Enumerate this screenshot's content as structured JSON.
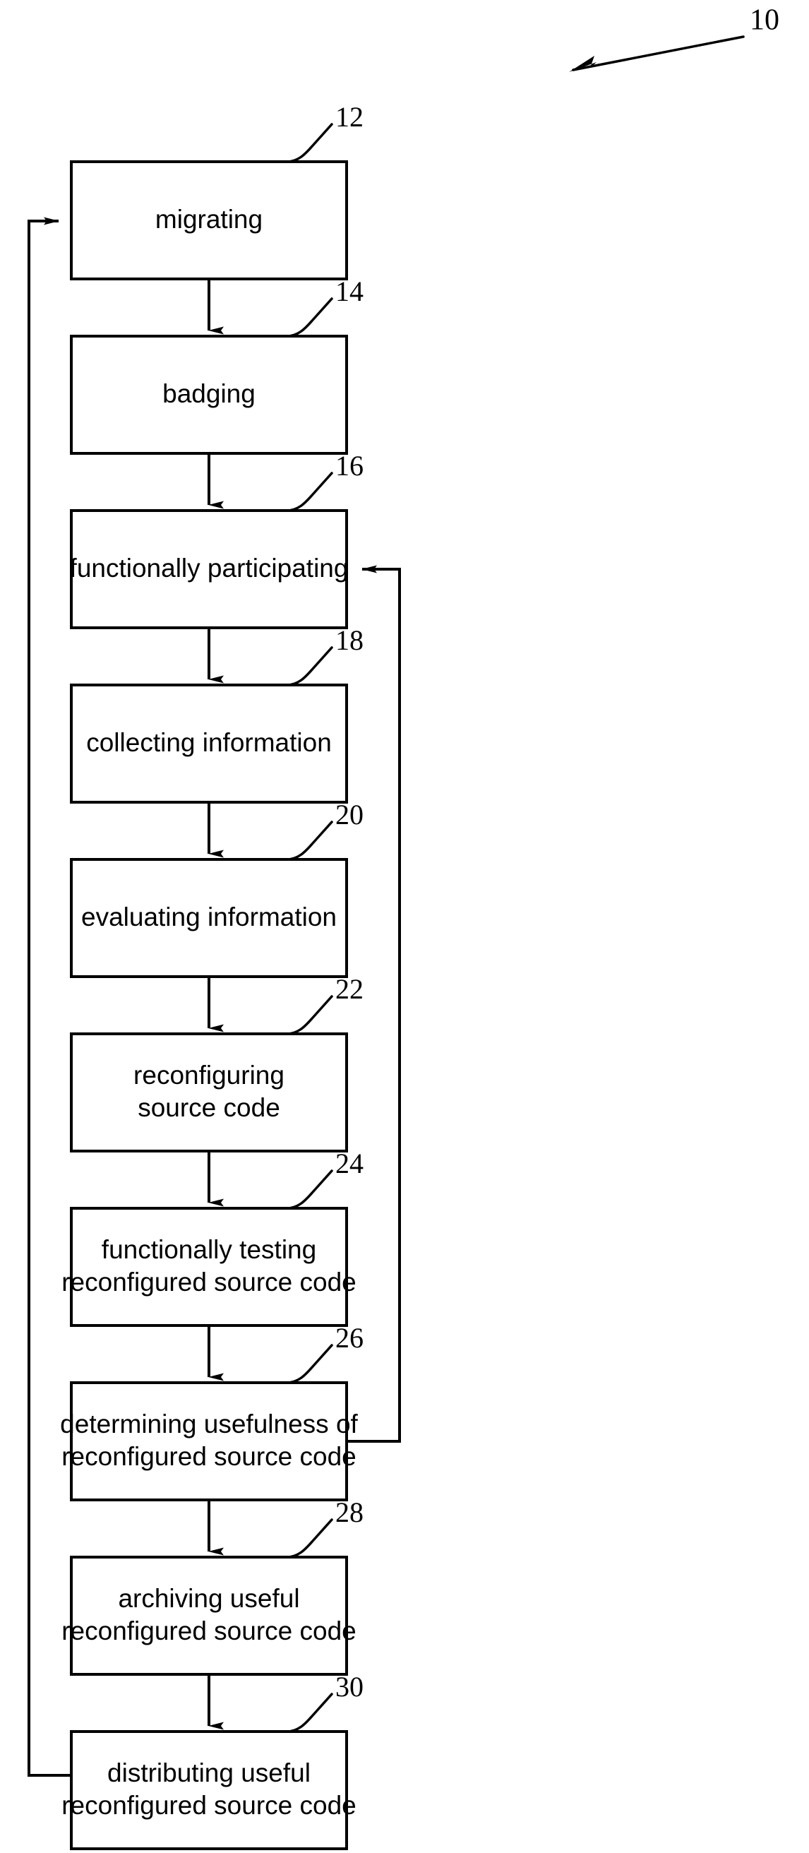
{
  "figure": {
    "reference_label": "10",
    "title": "Method flow diagram",
    "background_color": "#ffffff",
    "line_color": "#000000"
  },
  "steps": [
    {
      "ref": "12",
      "lines": [
        "migrating"
      ],
      "line1": "migrating",
      "line2": ""
    },
    {
      "ref": "14",
      "lines": [
        "badging"
      ],
      "line1": "badging",
      "line2": ""
    },
    {
      "ref": "16",
      "lines": [
        "functionally participating"
      ],
      "line1": "functionally participating",
      "line2": ""
    },
    {
      "ref": "18",
      "lines": [
        "collecting information"
      ],
      "line1": "collecting information",
      "line2": ""
    },
    {
      "ref": "20",
      "lines": [
        "evaluating information"
      ],
      "line1": "evaluating information",
      "line2": ""
    },
    {
      "ref": "22",
      "lines": [
        "reconfiguring",
        "source code"
      ],
      "line1": "reconfiguring",
      "line2": "source code"
    },
    {
      "ref": "24",
      "lines": [
        "functionally testing",
        "reconfigured source code"
      ],
      "line1": "functionally testing",
      "line2": "reconfigured source code"
    },
    {
      "ref": "26",
      "lines": [
        "determining usefulness of",
        "reconfigured source code"
      ],
      "line1": "determining usefulness of",
      "line2": "reconfigured source code"
    },
    {
      "ref": "28",
      "lines": [
        "archiving useful",
        "reconfigured source code"
      ],
      "line1": "archiving useful",
      "line2": "reconfigured source code"
    },
    {
      "ref": "30",
      "lines": [
        "distributing useful",
        "reconfigured source code"
      ],
      "line1": "distributing useful",
      "line2": "reconfigured source code"
    }
  ],
  "connectors": {
    "sequential_arrows": 9,
    "feedback_left": {
      "from_step_ref": "30",
      "to_step_ref": "12",
      "description": "left loop from distributing box back to migrating box"
    },
    "feedback_right": {
      "from_step_ref": "26",
      "to_step_ref": "16",
      "description": "right loop from determining usefulness box back to functionally participating box"
    }
  }
}
